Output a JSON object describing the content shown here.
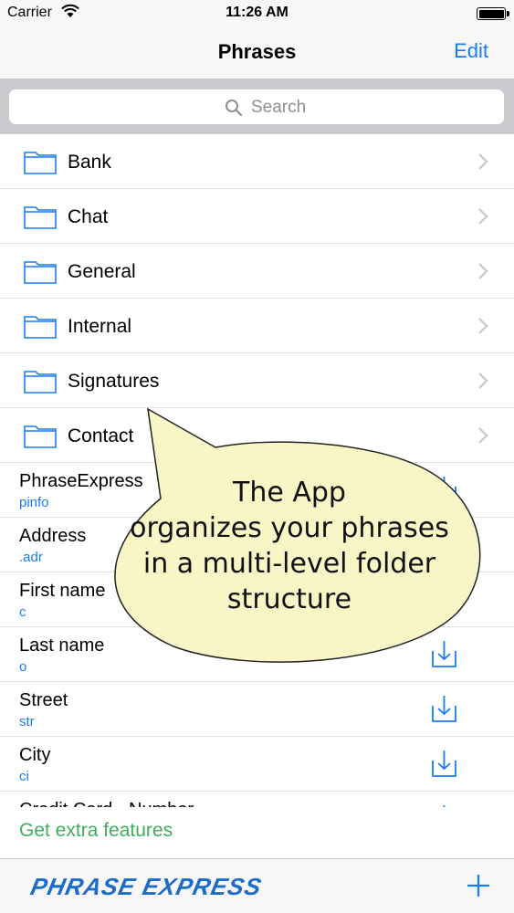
{
  "status_bar": {
    "carrier": "Carrier",
    "time": "11:26 AM"
  },
  "nav": {
    "title": "Phrases",
    "edit_label": "Edit"
  },
  "search": {
    "placeholder": "Search"
  },
  "folders": [
    {
      "label": "Bank"
    },
    {
      "label": "Chat"
    },
    {
      "label": "General"
    },
    {
      "label": "Internal"
    },
    {
      "label": "Signatures"
    },
    {
      "label": "Contact"
    }
  ],
  "phrases": [
    {
      "name": "PhraseExpress",
      "abbr": "pinfo"
    },
    {
      "name": "Address",
      "abbr": ".adr"
    },
    {
      "name": "First name",
      "abbr": "c"
    },
    {
      "name": "Last name",
      "abbr": "o"
    },
    {
      "name": "Street",
      "abbr": "str"
    },
    {
      "name": "City",
      "abbr": "ci"
    }
  ],
  "partial_phrase": {
    "name": "Credit Card - Number"
  },
  "extra_link": "Get extra features",
  "toolbar": {
    "logo": "PHRASE EXPRESS"
  },
  "callout": {
    "lines": [
      "The App",
      "organizes your phrases",
      "in a multi-level folder",
      "structure"
    ]
  },
  "colors": {
    "accent": "#1a7cf5",
    "extra_green": "#3fae5d",
    "callout_fill": "#f8f6c6",
    "logo_blue": "#1b6cc8"
  }
}
